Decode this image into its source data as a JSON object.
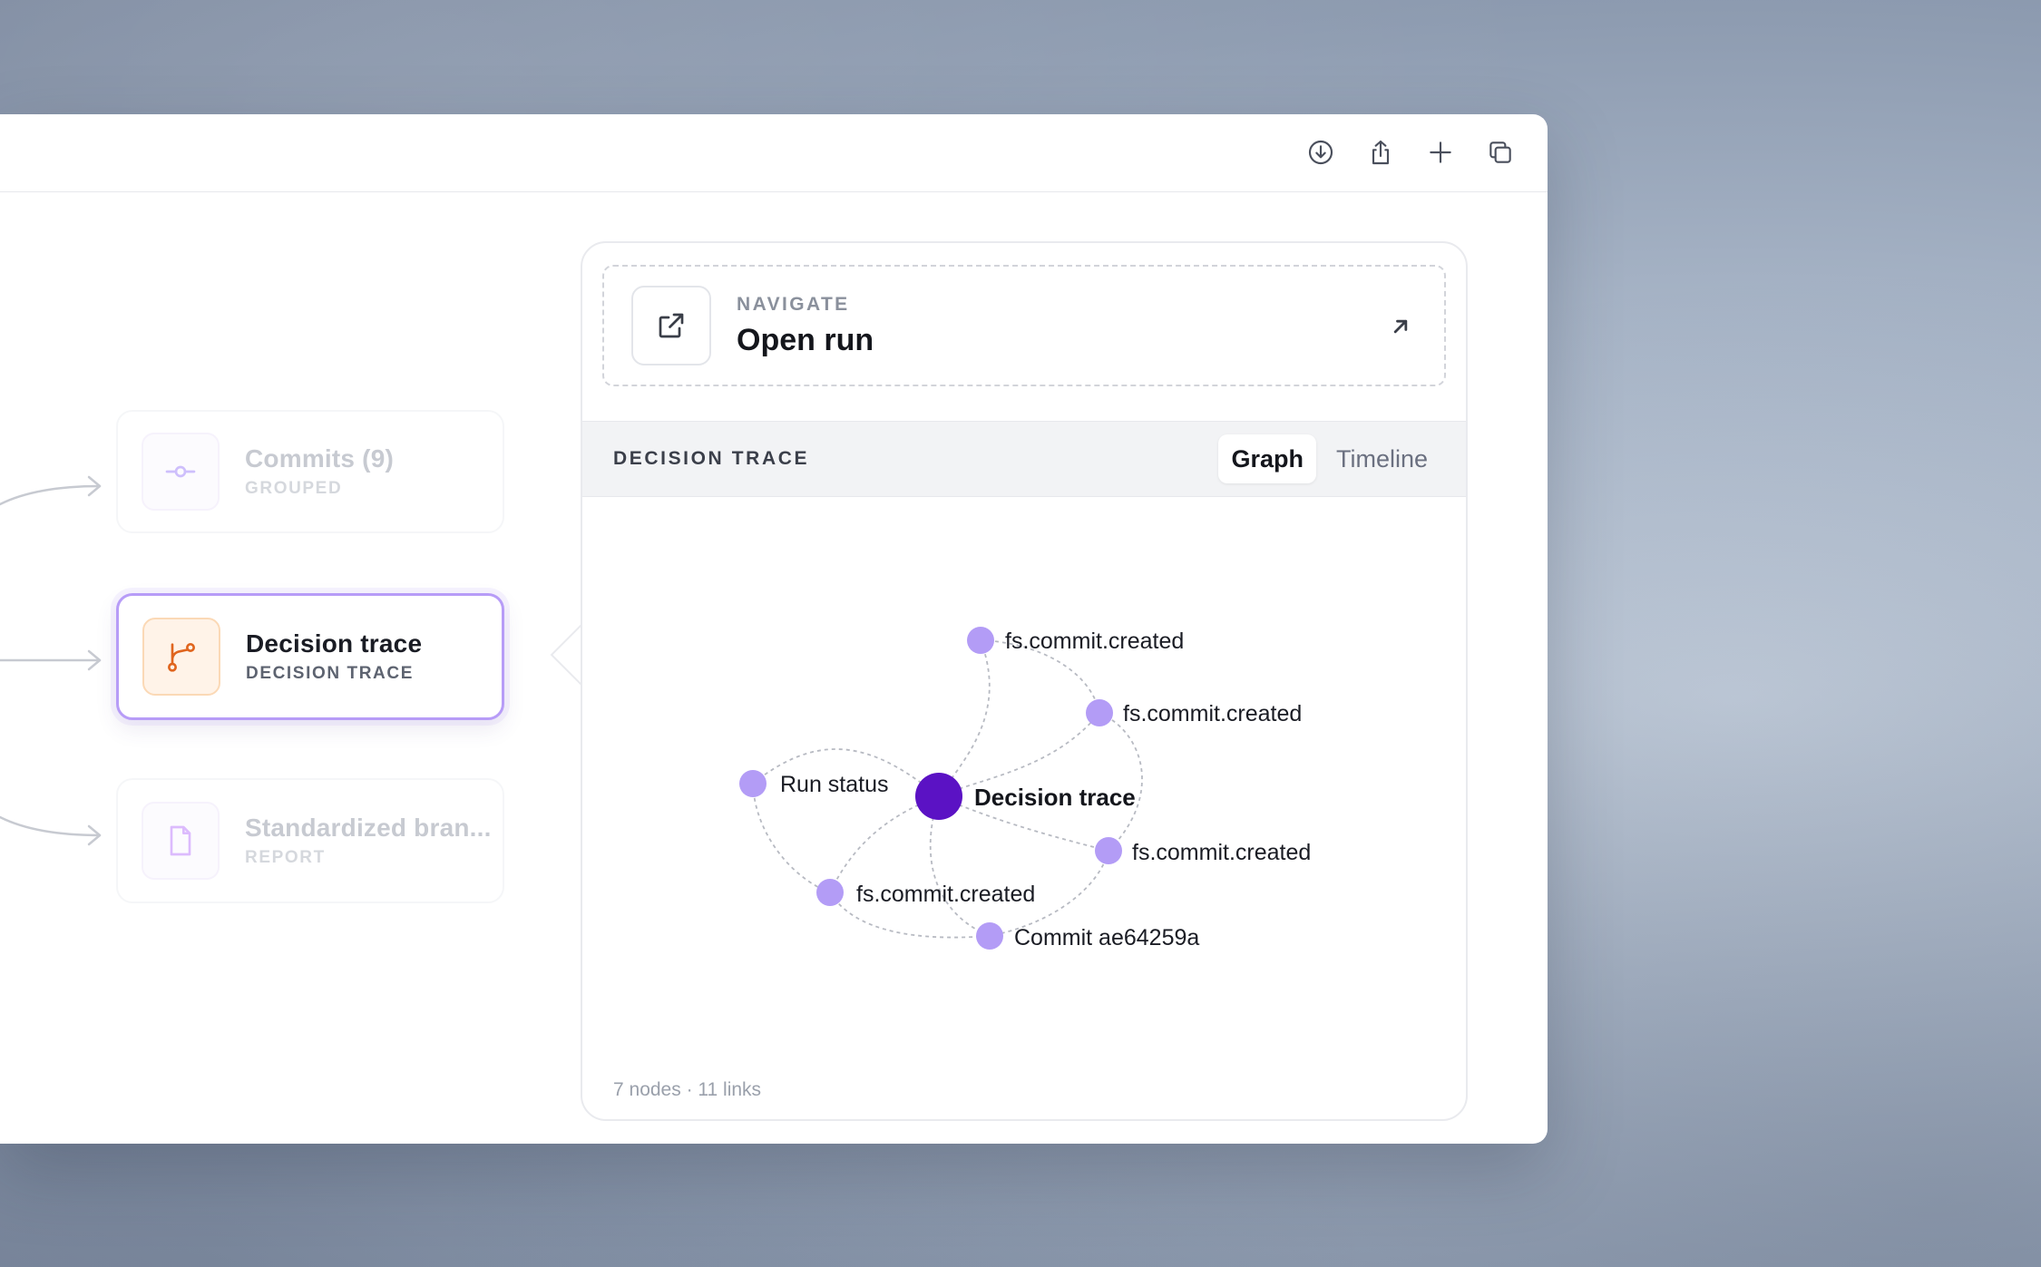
{
  "toolbar": {
    "download_icon": "download-icon",
    "share_icon": "share-icon",
    "add_icon": "plus-icon",
    "copy_icon": "copy-icon"
  },
  "nodes": [
    {
      "title": "Commits (9)",
      "subtitle": "GROUPED",
      "icon": "commit-icon",
      "state": "faded"
    },
    {
      "title": "Decision trace",
      "subtitle": "DECISION TRACE",
      "icon": "branch-icon",
      "state": "active"
    },
    {
      "title": "Standardized bran...",
      "subtitle": "REPORT",
      "icon": "document-icon",
      "state": "faded"
    }
  ],
  "navigate": {
    "label": "NAVIGATE",
    "title": "Open run"
  },
  "trace": {
    "title": "DECISION TRACE",
    "tabs": [
      "Graph",
      "Timeline"
    ],
    "active_tab": "Graph",
    "footer": "7 nodes · 11 links"
  },
  "graph": {
    "center": {
      "label": "Decision trace",
      "color": "#5b12c4"
    },
    "node_color": "#b39cf6",
    "nodes": [
      {
        "id": "n1",
        "label": "fs.commit.created"
      },
      {
        "id": "n2",
        "label": "fs.commit.created"
      },
      {
        "id": "n3",
        "label": "Run status"
      },
      {
        "id": "n4",
        "label": "fs.commit.created"
      },
      {
        "id": "n5",
        "label": "fs.commit.created"
      },
      {
        "id": "n6",
        "label": "Commit ae64259a"
      }
    ]
  },
  "colors": {
    "accent": "#b79cf7",
    "center_node": "#5b12c4",
    "orange_icon": "#e0651e"
  }
}
